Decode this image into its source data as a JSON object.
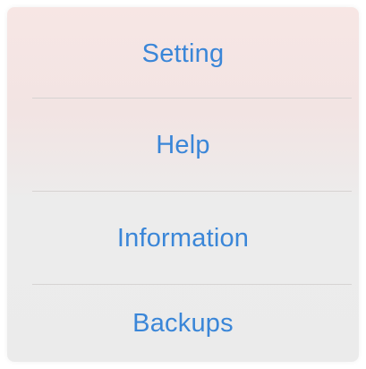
{
  "menu": {
    "items": [
      {
        "label": "Setting"
      },
      {
        "label": "Help"
      },
      {
        "label": "Information"
      },
      {
        "label": "Backups"
      }
    ],
    "accent_color": "#3a86d8"
  }
}
